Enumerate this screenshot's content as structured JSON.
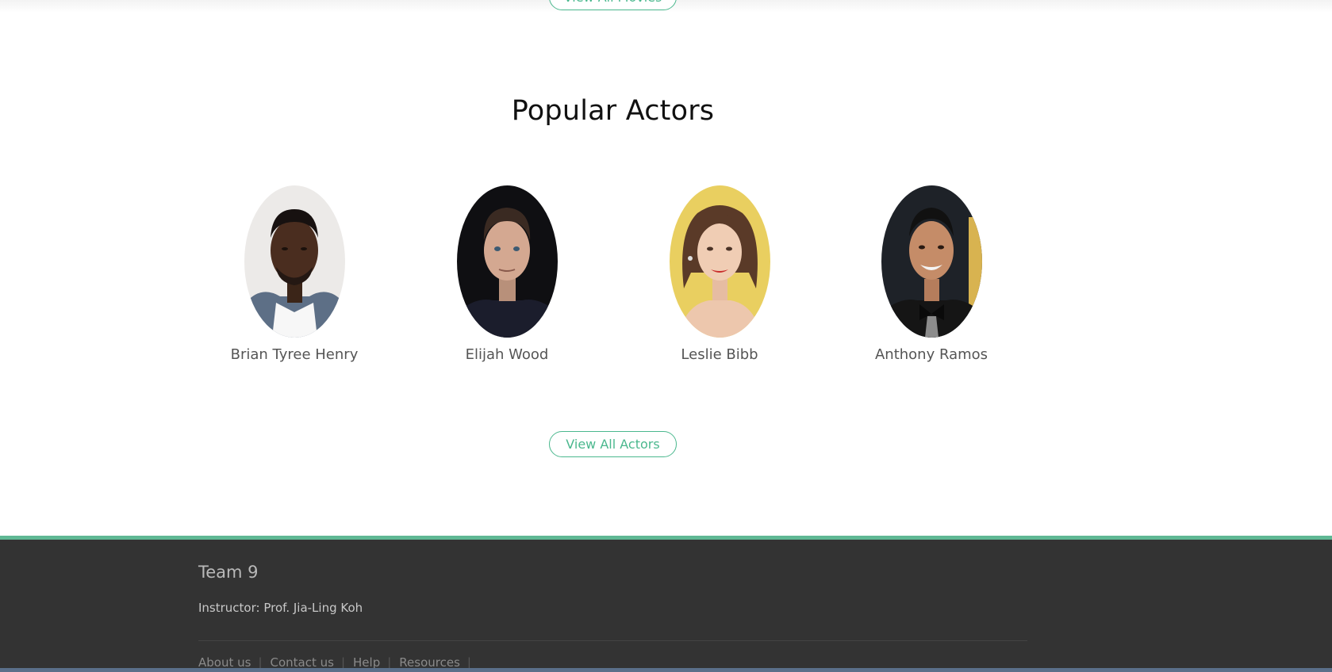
{
  "movies_section": {
    "view_all_label": "View All Movies"
  },
  "actors_section": {
    "title": "Popular Actors",
    "actors": [
      {
        "name": "Brian Tyree Henry"
      },
      {
        "name": "Elijah Wood"
      },
      {
        "name": "Leslie Bibb"
      },
      {
        "name": "Anthony Ramos"
      }
    ],
    "view_all_label": "View All Actors"
  },
  "footer": {
    "team": "Team 9",
    "instructor": "Instructor: Prof. Jia-Ling Koh",
    "links": [
      {
        "label": "About us"
      },
      {
        "label": "Contact us"
      },
      {
        "label": "Help"
      },
      {
        "label": "Resources"
      }
    ],
    "separator": "|"
  },
  "colors": {
    "accent": "#4bb88e",
    "footer_bg": "#333333",
    "footer_border": "#5fb894"
  }
}
